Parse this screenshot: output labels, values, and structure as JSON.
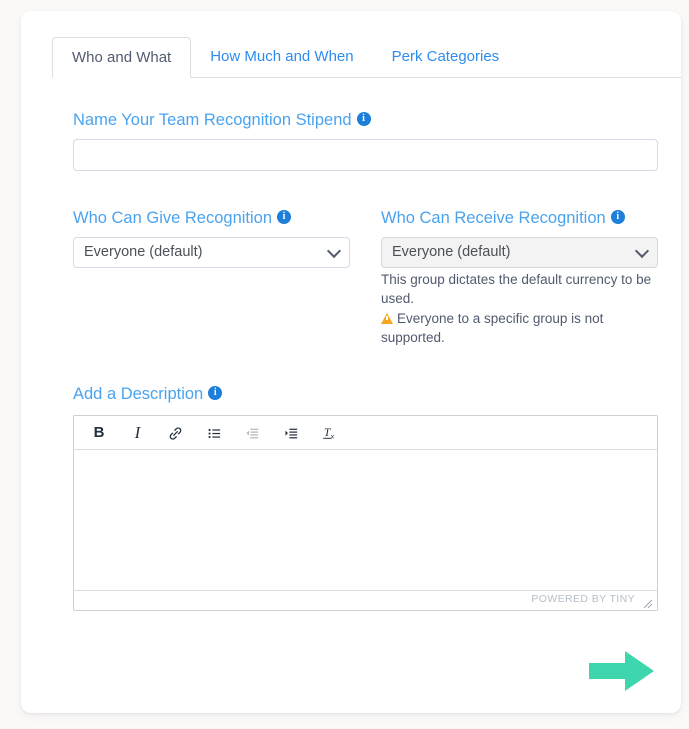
{
  "tabs": [
    {
      "label": "Who and What",
      "active": true
    },
    {
      "label": "How Much and When",
      "active": false
    },
    {
      "label": "Perk Categories",
      "active": false
    }
  ],
  "form": {
    "name_field": {
      "label": "Name Your Team Recognition Stipend",
      "value": "",
      "placeholder": ""
    },
    "who_can_give": {
      "label": "Who Can Give Recognition",
      "selected": "Everyone (default)",
      "disabled": false
    },
    "who_can_receive": {
      "label": "Who Can Receive Recognition",
      "selected": "Everyone (default)",
      "disabled": true,
      "helper_text": "This group dictates the default currency to be used.",
      "warning_text": "Everyone to a specific group is not supported."
    },
    "description": {
      "label": "Add a Description",
      "body": "",
      "toolbar": [
        {
          "name": "bold-icon",
          "glyph": "B"
        },
        {
          "name": "italic-icon",
          "glyph": "I"
        },
        {
          "name": "link-icon",
          "glyph": ""
        },
        {
          "name": "bullet-list-icon",
          "glyph": ""
        },
        {
          "name": "outdent-icon",
          "glyph": ""
        },
        {
          "name": "indent-icon",
          "glyph": ""
        },
        {
          "name": "clear-formatting-icon",
          "glyph": ""
        }
      ],
      "status_text": "POWERED BY TINY"
    }
  },
  "next_button": {
    "name": "next-arrow",
    "color": "#3ed6ac"
  },
  "colors": {
    "accent_blue": "#4aa3f0",
    "link_blue": "#2d8cf0",
    "text_dark": "#515a6e",
    "warning_amber": "#f5a623",
    "arrow_green": "#3ed6ac",
    "page_bg": "#faf9f8",
    "card_bg": "#ffffff"
  }
}
